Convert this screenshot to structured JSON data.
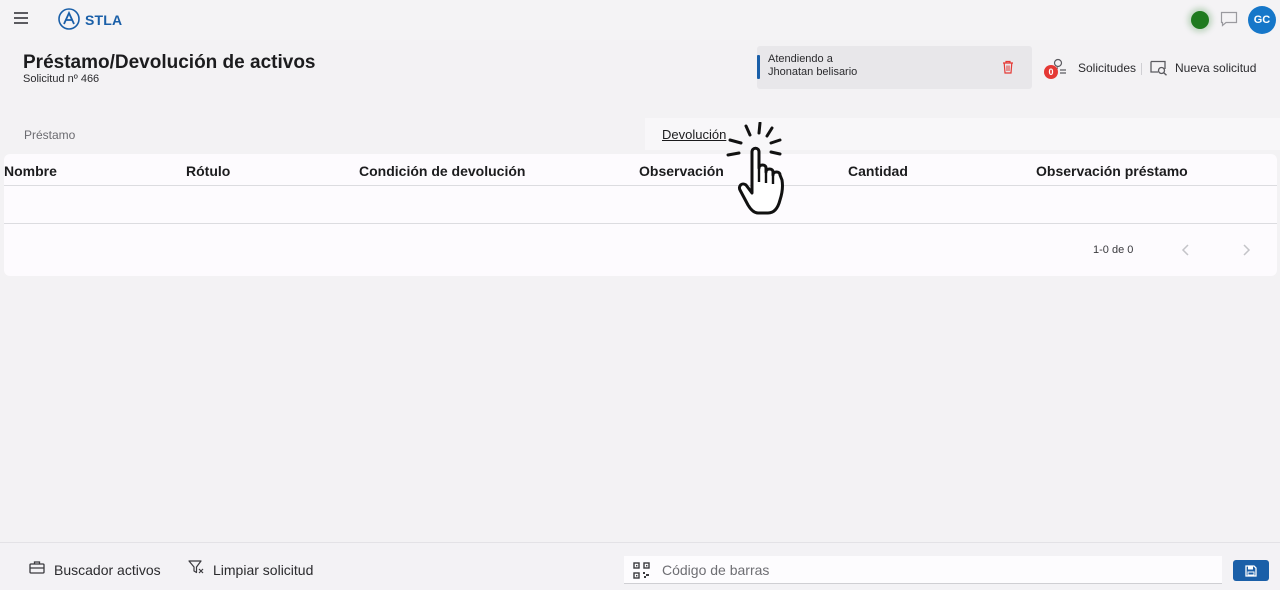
{
  "app": {
    "brand": "STLA",
    "user_initials": "GC",
    "status_color": "#1f7a1f",
    "accent_color": "#1a5fa8"
  },
  "header": {
    "title": "Préstamo/Devolución de activos",
    "subtitle": "Solicitud nº 466"
  },
  "attending": {
    "line1": "Atendiendo a",
    "line2": "Jhonatan belisario"
  },
  "actions": {
    "solicitudes_badge": "0",
    "solicitudes_label": "Solicitudes",
    "nueva_label": "Nueva solicitud"
  },
  "tabs": [
    {
      "label": "Préstamo",
      "active": false
    },
    {
      "label": "Devolución",
      "active": true
    }
  ],
  "table": {
    "columns": [
      "Nombre",
      "Rótulo",
      "Condición de devolución",
      "Observación",
      "Cantidad",
      "Observación préstamo"
    ],
    "rows": [],
    "pager_text": "1-0 de 0"
  },
  "bottom": {
    "buscador_label": "Buscador activos",
    "limpiar_label": "Limpiar solicitud",
    "barcode_placeholder": "Código de barras"
  },
  "icons": {
    "menu": "hamburger-icon",
    "logo": "stla-logo",
    "chat": "chat-icon",
    "trash": "trash-icon",
    "solicitudes": "requests-icon",
    "nueva": "new-request-icon",
    "buscador": "briefcase-icon",
    "limpiar": "filter-clear-icon",
    "barcode": "qr-code-icon",
    "save": "save-icon",
    "pointer": "click-hand-icon"
  }
}
